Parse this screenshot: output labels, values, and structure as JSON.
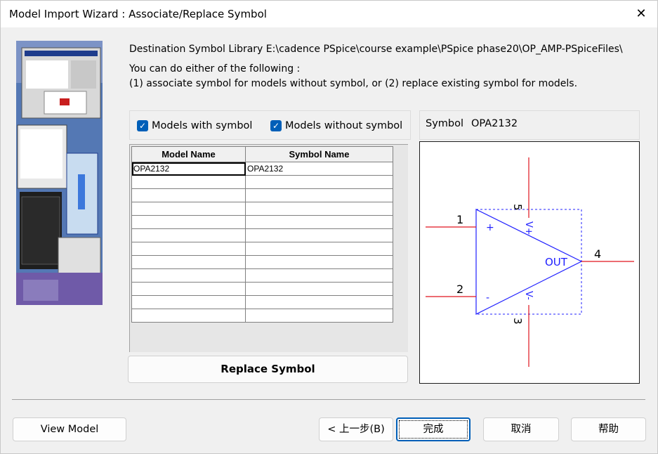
{
  "window": {
    "title": "Model Import Wizard : Associate/Replace Symbol",
    "close_glyph": "✕"
  },
  "header": {
    "destination_line": "Destination Symbol Library E:\\cadence PSpice\\course example\\PSpice phase20\\OP_AMP-PSpiceFiles\\",
    "instruction_line1": "You can do either of the following :",
    "instruction_line2": "(1) associate symbol for models without symbol, or (2) replace existing symbol for models."
  },
  "filters": {
    "with_symbol": {
      "label": "Models with symbol",
      "checked": true
    },
    "without_symbol": {
      "label": "Models without symbol",
      "checked": true
    }
  },
  "table": {
    "columns": [
      "Model Name",
      "Symbol Name"
    ],
    "rows": [
      [
        "OPA2132",
        "OPA2132"
      ],
      [
        "",
        ""
      ],
      [
        "",
        ""
      ],
      [
        "",
        ""
      ],
      [
        "",
        ""
      ],
      [
        "",
        ""
      ],
      [
        "",
        ""
      ],
      [
        "",
        ""
      ],
      [
        "",
        ""
      ],
      [
        "",
        ""
      ],
      [
        "",
        ""
      ],
      [
        "",
        ""
      ]
    ]
  },
  "replace_button": "Replace Symbol",
  "symbol": {
    "label": "Symbol",
    "name": "OPA2132",
    "pins": {
      "p1": "1",
      "p2": "2",
      "p3": "3",
      "p4": "4",
      "p5": "5"
    },
    "plus": "+",
    "minus": "-",
    "vplus": "V+",
    "vminus": "V-",
    "out": "OUT"
  },
  "footer": {
    "view_model": "View Model",
    "back": "< 上一步(B)",
    "finish": "完成",
    "cancel": "取消",
    "help": "帮助"
  },
  "colors": {
    "accent": "#005fb8",
    "pin_red": "#e0141e",
    "body_blue": "#2020ff"
  }
}
